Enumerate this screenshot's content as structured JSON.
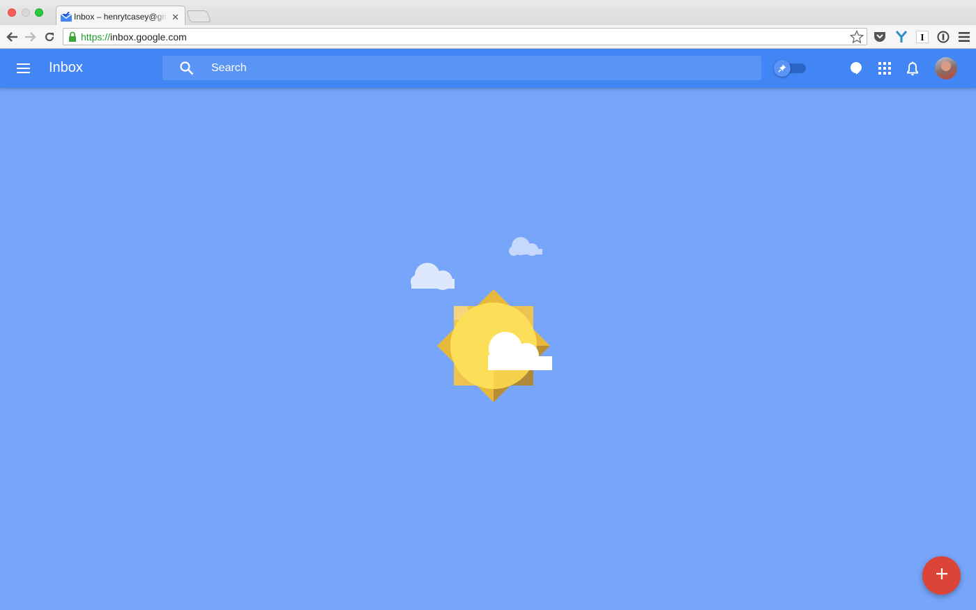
{
  "browser": {
    "tab": {
      "title": "Inbox – henrytcasey@gmail.com",
      "favicon": "inbox-icon"
    },
    "url": {
      "scheme": "https://",
      "host": "inbox.google.com"
    },
    "extensions": [
      "pocket-icon",
      "y-extension-icon",
      "instapaper-icon",
      "onepassword-icon",
      "chrome-menu-icon"
    ]
  },
  "app": {
    "title": "Inbox",
    "search": {
      "placeholder": "Search"
    },
    "pinned_toggle": {
      "on": false,
      "icon": "pin-icon"
    },
    "actions": [
      "hangouts-icon",
      "apps-grid-icon",
      "notifications-bell-icon",
      "account-avatar"
    ],
    "fab": {
      "icon": "plus-icon"
    }
  },
  "colors": {
    "app_bar": "#4285f4",
    "background": "#77a5fa",
    "fab": "#db4437"
  }
}
